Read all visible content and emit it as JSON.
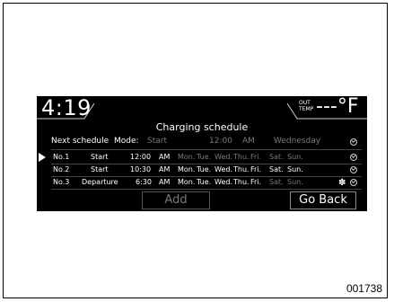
{
  "status_bar": {
    "clock": "4:19",
    "out_temp_label_1": "OUT",
    "out_temp_label_2": "TEMP",
    "out_temp_value": "---°F"
  },
  "screen_title": "Charging schedule",
  "next_schedule": {
    "label": "Next schedule",
    "mode_label": "Mode:",
    "mode_value": "Start",
    "time": "12:00",
    "ampm": "AM",
    "day": "Wednesday"
  },
  "schedules": [
    {
      "no": "No.1",
      "mode": "Start",
      "time": "12:00",
      "ampm": "AM",
      "days": [
        "Mon.",
        "Tue.",
        "Wed.",
        "Thu.",
        "Fri.",
        "Sat.",
        "Sun."
      ],
      "active": [
        false,
        false,
        false,
        false,
        false,
        false,
        false
      ]
    },
    {
      "no": "No.2",
      "mode": "Start",
      "time": "10:30",
      "ampm": "AM",
      "days": [
        "Mon.",
        "Tue.",
        "Wed.",
        "Thu.",
        "Fri.",
        "Sat.",
        "Sun."
      ],
      "active": [
        true,
        true,
        true,
        true,
        true,
        true,
        true
      ]
    },
    {
      "no": "No.3",
      "mode": "Departure",
      "time": "6:30",
      "ampm": "AM",
      "days": [
        "Mon.",
        "Tue.",
        "Wed.",
        "Thu.",
        "Fri.",
        "Sat.",
        "Sun."
      ],
      "active": [
        true,
        true,
        true,
        true,
        true,
        false,
        false
      ]
    }
  ],
  "buttons": {
    "add": "Add",
    "go_back": "Go Back"
  },
  "figure_number": "001738",
  "icons": {
    "selector": "play-arrow-icon",
    "check": "check-circle-icon",
    "climate": "fan-icon"
  }
}
